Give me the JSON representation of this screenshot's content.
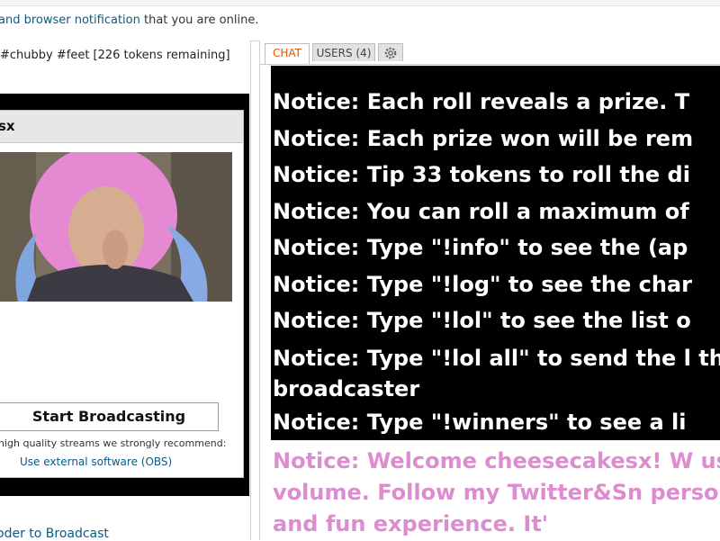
{
  "notification": {
    "prefix": "and browser notification",
    "suffix": " that you are online."
  },
  "room": {
    "subject": "#chubby #feet [226 tokens remaining]"
  },
  "broadcast": {
    "username_fragment": "sx",
    "start_button": "Start Broadcasting",
    "quality_hint": "high quality streams we strongly recommend:",
    "external_software_link": "Use external software (OBS)",
    "encoder_link": "oder to Broadcast"
  },
  "chat": {
    "tabs": {
      "chat": "CHAT",
      "users": "USERS (4)"
    },
    "messages_black": [
      "Notice: Each roll reveals a prize. T",
      "Notice: Each prize won will be rem",
      "Notice: Tip 33 tokens to roll the di",
      "Notice: You can roll a maximum of",
      "Notice: Type \"!info\" to see the (ap",
      "Notice: Type \"!log\" to see the char",
      "Notice: Type \"!lol\" to see the list o"
    ],
    "message_wrap": "Notice: Type \"!lol all\" to send the l the broadcaster",
    "message_last": "Notice: Type \"!winners\" to see a li",
    "message_pink": "Notice: Welcome cheesecakesx! W use volume. Follow my Twitter&Sn personable and fun experience. It'"
  },
  "colors": {
    "chat_tab_accent": "#dc5500",
    "link": "#0a5a83",
    "notice_pink": "#dd8ccf",
    "notice_background": "#000000"
  }
}
